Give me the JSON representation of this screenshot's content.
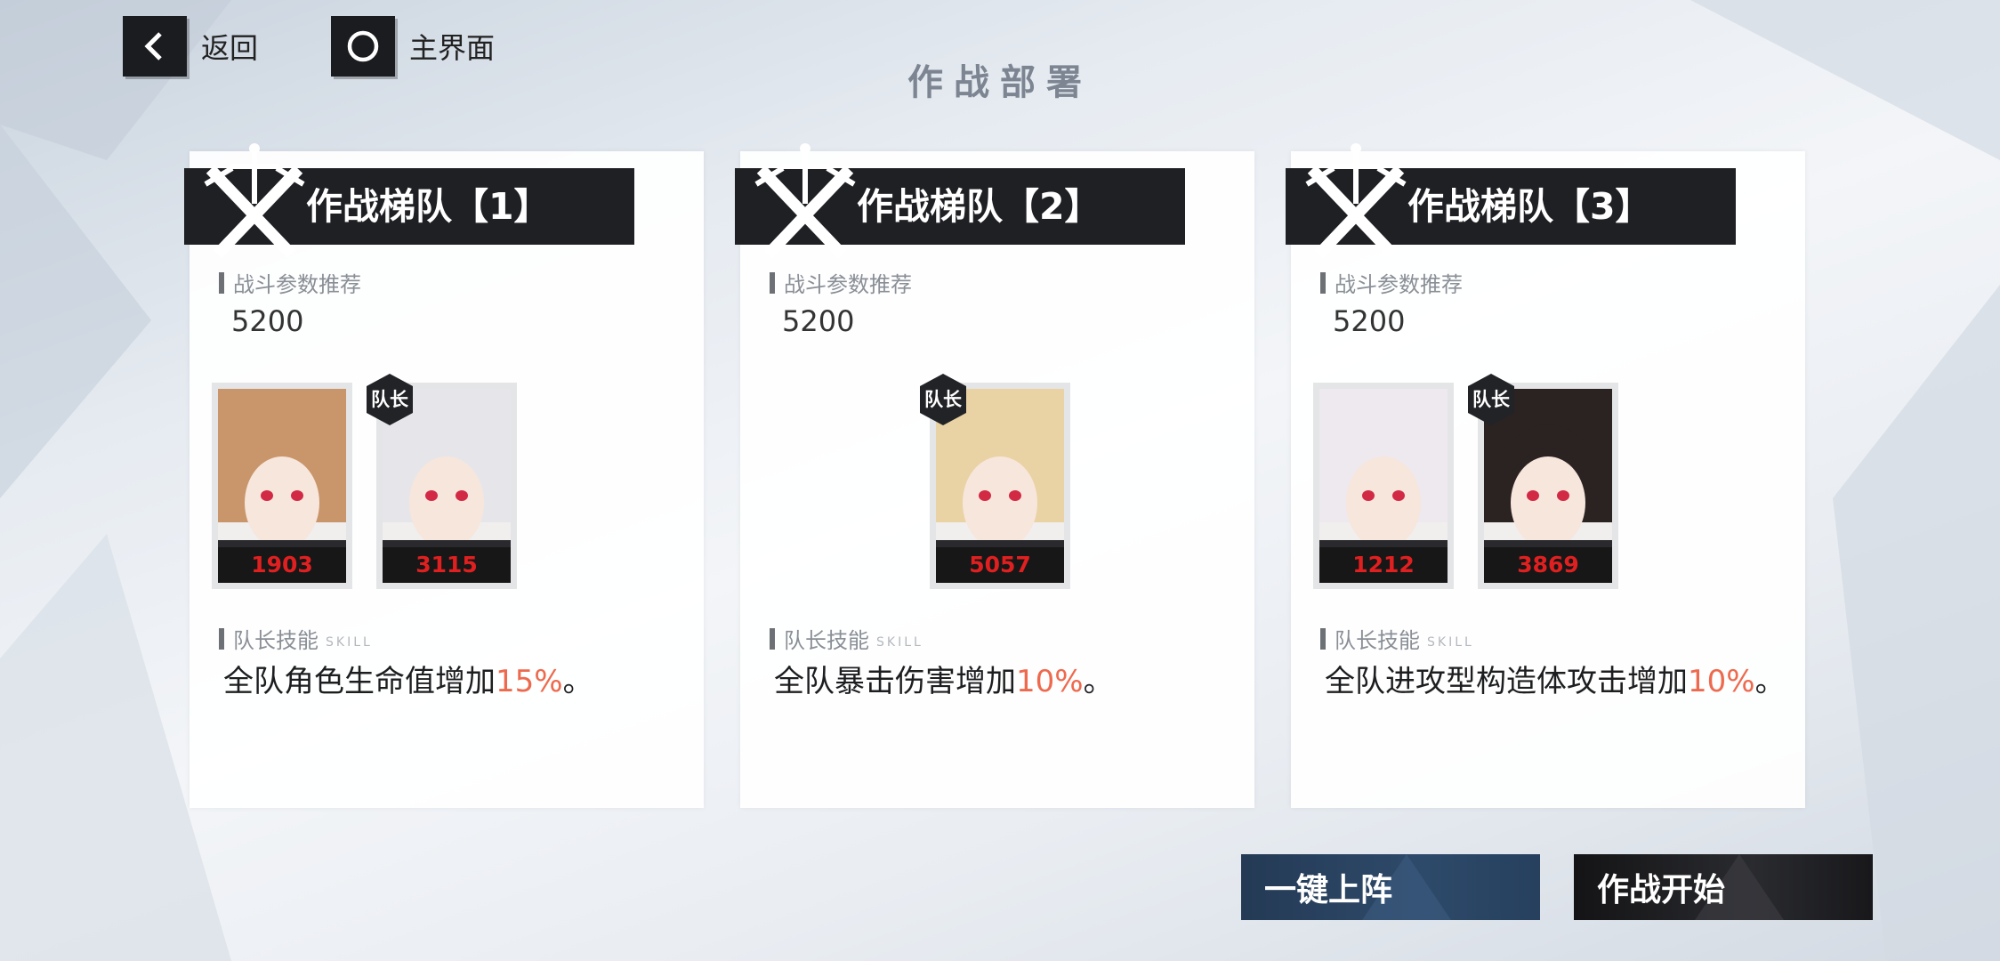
{
  "nav": {
    "back_label": "返回",
    "home_label": "主界面"
  },
  "page_title": "作战部署",
  "labels": {
    "power": "战斗参数推荐",
    "leader_skill": "队长技能",
    "leader_skill_sub": "SKILL",
    "leader_badge": "队长"
  },
  "teams": [
    {
      "title": "作战梯队【1】",
      "recommended_power": "5200",
      "members": [
        {
          "cp": "1903",
          "is_leader": false,
          "hair": "#c9956b"
        },
        {
          "cp": "3115",
          "is_leader": true,
          "hair": "#e6e6ea"
        }
      ],
      "skill_prefix": "全队角色生命值增加",
      "skill_value": "15%",
      "skill_suffix": "。"
    },
    {
      "title": "作战梯队【2】",
      "recommended_power": "5200",
      "members": [
        {
          "cp": "5057",
          "is_leader": true,
          "hair": "#e9d3a4"
        }
      ],
      "skill_prefix": "全队暴击伤害增加",
      "skill_value": "10%",
      "skill_suffix": "。"
    },
    {
      "title": "作战梯队【3】",
      "recommended_power": "5200",
      "members": [
        {
          "cp": "1212",
          "is_leader": false,
          "hair": "#eee9ee"
        },
        {
          "cp": "3869",
          "is_leader": true,
          "hair": "#2b2222"
        }
      ],
      "skill_prefix": "全队进攻型构造体攻击增加",
      "skill_value": "10%",
      "skill_suffix": "。"
    }
  ],
  "buttons": {
    "auto_deploy": "一键上阵",
    "start_battle": "作战开始"
  },
  "colors": {
    "accent_pct": "#ee6a4e",
    "cp_red": "#e02020",
    "header_dark": "#1f2024",
    "auto_btn": "#2e4a6a"
  }
}
